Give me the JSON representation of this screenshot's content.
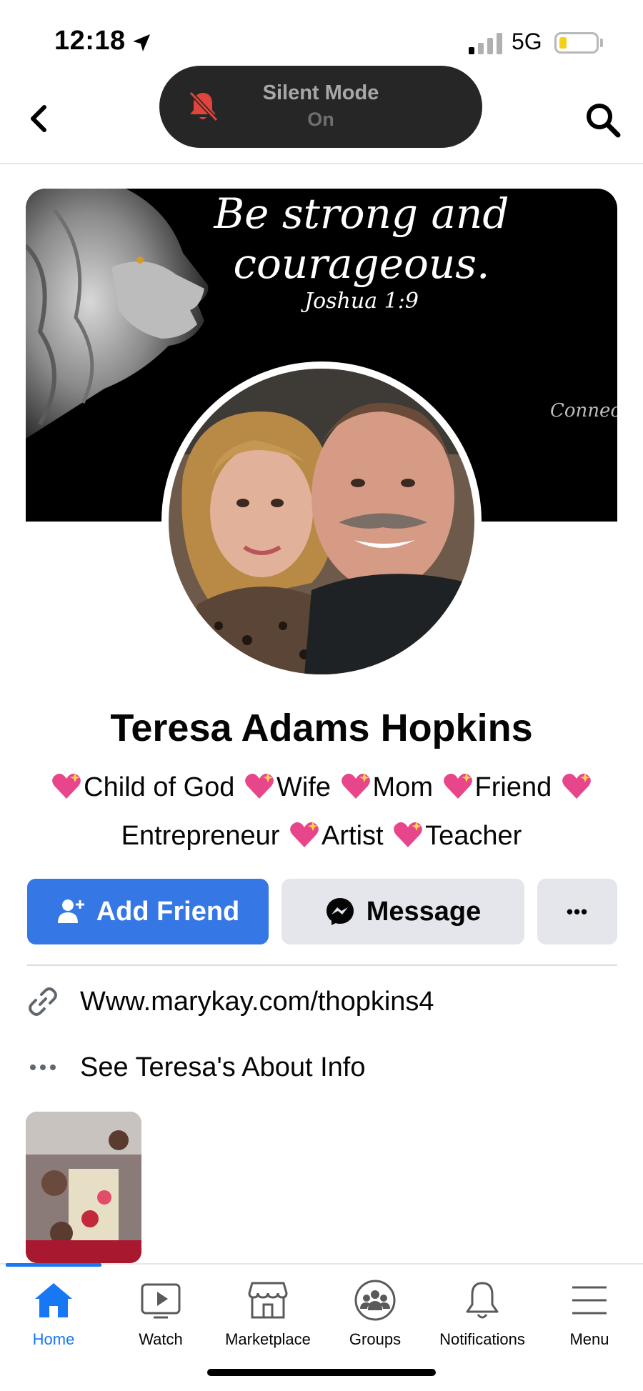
{
  "status_bar": {
    "time": "12:18",
    "network": "5G"
  },
  "silent_banner": {
    "title": "Silent Mode",
    "state": "On"
  },
  "cover": {
    "quote_line1": "Be strong and",
    "quote_line2": "courageous.",
    "reference": "Joshua 1:9",
    "signature": "Connect"
  },
  "profile": {
    "name": "Teresa Adams Hopkins",
    "bio_items": [
      "Child of God",
      "Wife",
      "Mom",
      "Friend",
      "Entrepreneur",
      "Artist",
      "Teacher"
    ]
  },
  "actions": {
    "add_friend": "Add Friend",
    "message": "Message",
    "more": "•••"
  },
  "info": {
    "website": "Www.marykay.com/thopkins4",
    "about": "See Teresa's About Info"
  },
  "tabs": [
    {
      "label": "Home",
      "icon": "home-icon",
      "active": true
    },
    {
      "label": "Watch",
      "icon": "watch-icon"
    },
    {
      "label": "Marketplace",
      "icon": "marketplace-icon"
    },
    {
      "label": "Groups",
      "icon": "groups-icon"
    },
    {
      "label": "Notifications",
      "icon": "bell-icon"
    },
    {
      "label": "Menu",
      "icon": "menu-icon"
    }
  ],
  "colors": {
    "accent": "#1877f2",
    "add_button": "#3578e5",
    "secondary_button": "#e4e6eb",
    "heart": "#e8468a"
  }
}
